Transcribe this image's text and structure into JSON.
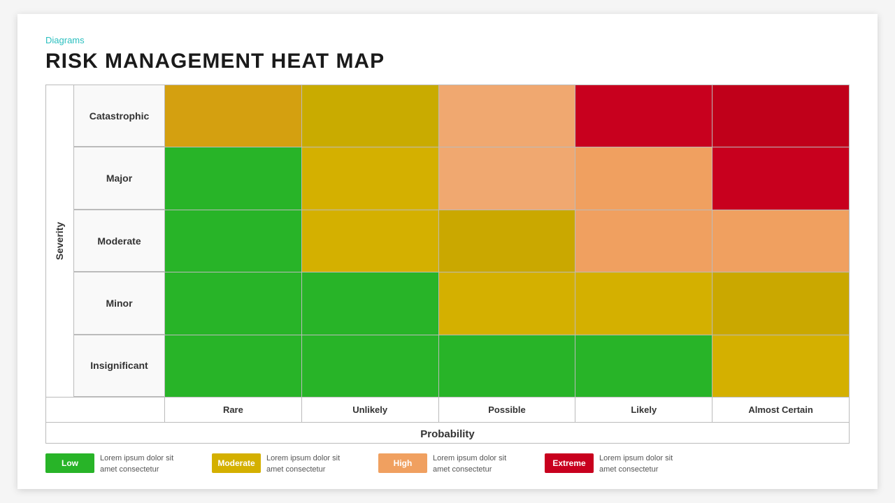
{
  "breadcrumb": "Diagrams",
  "title": "RISK MANAGEMENT HEAT MAP",
  "severity_label": "Severity",
  "probability_label": "Probability",
  "rows": [
    {
      "label": "Catastrophic",
      "cells": [
        {
          "color": "#d4a010"
        },
        {
          "color": "#c9ab00"
        },
        {
          "color": "#f0a870"
        },
        {
          "color": "#c8001e"
        },
        {
          "color": "#c0001a"
        }
      ]
    },
    {
      "label": "Major",
      "cells": [
        {
          "color": "#28b428"
        },
        {
          "color": "#d4b000"
        },
        {
          "color": "#f0a870"
        },
        {
          "color": "#f0a060"
        },
        {
          "color": "#c8001e"
        }
      ]
    },
    {
      "label": "Moderate",
      "cells": [
        {
          "color": "#28b428"
        },
        {
          "color": "#d4b000"
        },
        {
          "color": "#caa800"
        },
        {
          "color": "#f0a060"
        },
        {
          "color": "#f0a060"
        }
      ]
    },
    {
      "label": "Minor",
      "cells": [
        {
          "color": "#28b428"
        },
        {
          "color": "#28b428"
        },
        {
          "color": "#d4b000"
        },
        {
          "color": "#d4b000"
        },
        {
          "color": "#caa800"
        }
      ]
    },
    {
      "label": "Insignificant",
      "cells": [
        {
          "color": "#28b428"
        },
        {
          "color": "#28b428"
        },
        {
          "color": "#28b428"
        },
        {
          "color": "#28b428"
        },
        {
          "color": "#d4b000"
        }
      ]
    }
  ],
  "prob_labels": [
    "Rare",
    "Unlikely",
    "Possible",
    "Likely",
    "Almost Certain"
  ],
  "legend": [
    {
      "badge_label": "Low",
      "badge_color": "#28b428",
      "text": "Lorem ipsum dolor sit amet consectetur"
    },
    {
      "badge_label": "Moderate",
      "badge_color": "#d4b000",
      "text": "Lorem ipsum dolor sit amet consectetur"
    },
    {
      "badge_label": "High",
      "badge_color": "#f0a060",
      "text": "Lorem ipsum dolor sit amet consectetur"
    },
    {
      "badge_label": "Extreme",
      "badge_color": "#c8001e",
      "text": "Lorem ipsum dolor sit amet consectetur"
    }
  ]
}
